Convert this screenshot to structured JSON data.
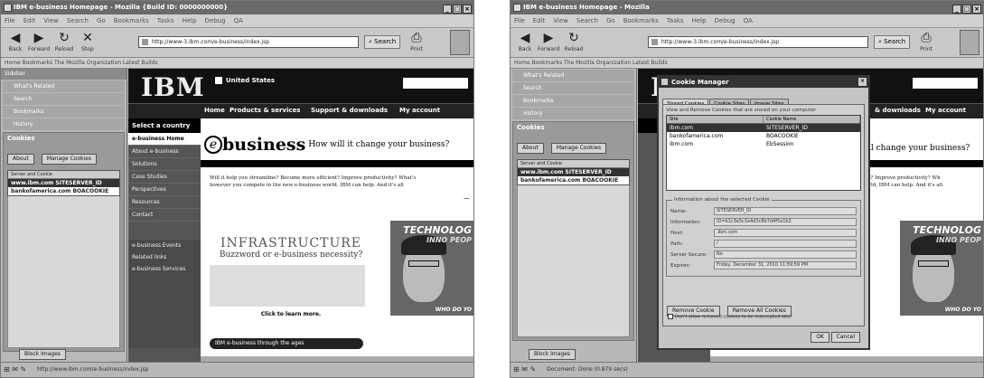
{
  "window1": {
    "title": "IBM e-business Homepage - Mozilla {Build ID: 0000000000}",
    "menu": [
      "File",
      "Edit",
      "View",
      "Search",
      "Go",
      "Bookmarks",
      "Tasks",
      "Help",
      "Debug",
      "QA"
    ],
    "nav": {
      "back": "Back",
      "forward": "Forward",
      "reload": "Reload",
      "stop": "Stop",
      "url": "http://www-3.ibm.com/e-business/index.jsp",
      "search": "Search",
      "print": "Print"
    },
    "personal_toolbar": "Home   Bookmarks   The Mozilla Organization   Latest Builds",
    "sidebar": {
      "header": "Sidebar",
      "items": [
        "What's Related",
        "Search",
        "Bookmarks",
        "History"
      ],
      "cookies_title": "Cookies",
      "about": "About",
      "manage": "Manage Cookies",
      "col_header": "Server and Cookie",
      "rows": [
        {
          "text": "www.ibm.com  SITESERVER_ID",
          "selected": true
        },
        {
          "text": "bankofamerica.com  BOACOOKIE",
          "selected": false
        }
      ],
      "bottom_button": "Block Images"
    },
    "page": {
      "logo": "IBM",
      "country": "United States",
      "nav": [
        "Home",
        "Products & services",
        "Support & downloads",
        "My account"
      ],
      "select_country": "Select a country",
      "leftnav": [
        "e-business Home",
        "About e-business",
        "Solutions",
        "Case Studies",
        "Perspectives",
        "Resources",
        "Contact"
      ],
      "leftnav_dark": [
        "e-business Events",
        "Related links",
        "e-business Services"
      ],
      "hero_e": "e",
      "hero_title": "business",
      "hero_question": "How will it change your business?",
      "para1": "Will it help you streamline? Become more efficient? Improve productivity? What's",
      "para2": "however you compete in the new e-business world, IBM can help. And it's all",
      "dash": "—",
      "infra_title": "INFRASTRUCTURE",
      "infra_sub": "Buzzword or e-business necessity?",
      "click": "Click to learn more.",
      "tech1": "TECHNOLOG",
      "tech2": "INNO PEOP",
      "tech3": "WHO DO YO",
      "banner": "IBM e-business through the ages"
    },
    "status": "http://www.ibm.com/e-business/index.jsp"
  },
  "window2": {
    "title": "IBM e-business Homepage - Mozilla",
    "menu": [
      "File",
      "Edit",
      "View",
      "Search",
      "Go",
      "Bookmarks",
      "Tasks",
      "Help",
      "Debug",
      "QA"
    ],
    "nav": {
      "back": "Back",
      "forward": "Forward",
      "reload": "Reload",
      "url": "http://www-3.ibm.com/e-business/index.jsp",
      "search": "Search",
      "print": "Print"
    },
    "personal_toolbar": "Home   Bookmarks   The Mozilla Organization   Latest Builds",
    "sidebar": {
      "items": [
        "What's Related",
        "Search",
        "Bookmarks",
        "History"
      ],
      "cookies_title": "Cookies",
      "about": "About",
      "manage": "Manage Cookies",
      "col_header": "Server and Cookie",
      "rows": [
        {
          "text": "www.ibm.com  SITESERVER_ID",
          "selected": true
        },
        {
          "text": "bankofamerica.com  BOACOOKIE",
          "selected": false
        }
      ],
      "bottom_button": "Block Images"
    },
    "page": {
      "nav_visible": [
        "& downloads",
        "My account"
      ],
      "hero_question": "ll change your business?",
      "para1": "ty? Improve productivity? Wh",
      "para2": "orld, IBM can help. And it's all"
    },
    "status": "Document: Done (0.879 secs)",
    "dialog": {
      "title": "Cookie Manager",
      "tabs": [
        "Stored Cookies",
        "Cookie Sites",
        "Image Sites"
      ],
      "desc": "View and Remove Cookies that are stored on your computer",
      "col_site": "Site",
      "col_name": "Cookie Name",
      "rows": [
        {
          "site": "ibm.com",
          "name": "SITESERVER_ID",
          "selected": true
        },
        {
          "site": "bankofamerica.com",
          "name": "BOACOOKIE",
          "selected": false
        },
        {
          "site": "ibm.com",
          "name": "EbSession",
          "selected": false
        }
      ],
      "info_legend": "Information about the selected Cookie",
      "fields": [
        {
          "label": "Name:",
          "value": "SITESERVER_ID"
        },
        {
          "label": "Information:",
          "value": "ID=b1c3e5c3a4d3c8b7d4f5a1b2"
        },
        {
          "label": "Host:",
          "value": ".ibm.com"
        },
        {
          "label": "Path:",
          "value": "/"
        },
        {
          "label": "Server Secure:",
          "value": "No"
        },
        {
          "label": "Expires:",
          "value": "Friday, December 31, 2010 11:59:59 PM"
        }
      ],
      "remove": "Remove Cookie",
      "remove_all": "Remove All Cookies",
      "checkbox": "Don't allow removed cookies to be reaccepted later",
      "ok": "OK",
      "cancel": "Cancel"
    }
  }
}
